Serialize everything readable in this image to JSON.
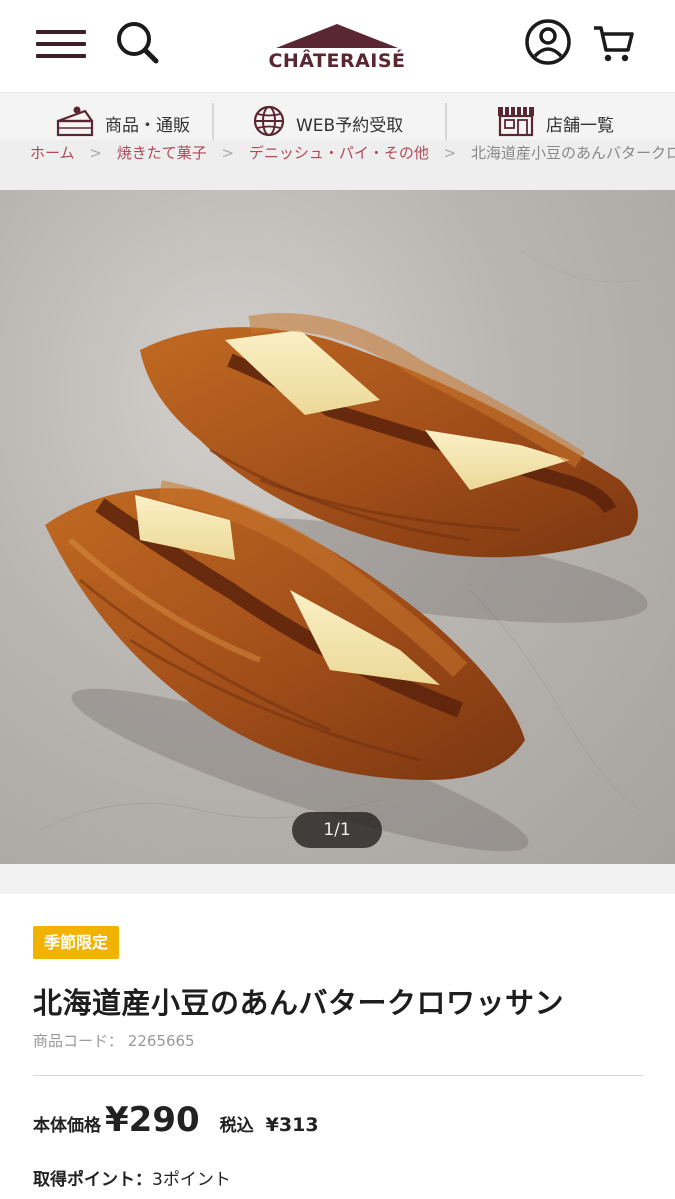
{
  "header": {
    "logo_text": "CHÂTERAISÉ",
    "menu_icon": "hamburger-menu-icon",
    "search_icon": "search-icon",
    "account_icon": "user-account-icon",
    "cart_icon": "cart-icon",
    "brand_color": "#5b2633"
  },
  "subnav": {
    "items": [
      {
        "label": "商品・通販",
        "icon": "cake-icon"
      },
      {
        "label": "WEB予約受取",
        "icon": "globe-icon"
      },
      {
        "label": "店舗一覧",
        "icon": "store-icon"
      }
    ]
  },
  "breadcrumb": {
    "items": [
      "ホーム",
      "焼きたて菓子",
      "デニッシュ・パイ・その他",
      "北海道産小豆のあんバタークロワッサン"
    ]
  },
  "gallery": {
    "counter": "1/1"
  },
  "product": {
    "badge": "季節限定",
    "badge_color": "#f2b200",
    "title": "北海道産小豆のあんバタークロワッサン",
    "code_label": "商品コード：",
    "code": "2265665",
    "price_label": "本体価格",
    "price_yen": "¥",
    "price": "290",
    "tax_label": "税込",
    "tax_price": "¥313",
    "points_label": "取得ポイント：",
    "points": "3ポイント"
  }
}
